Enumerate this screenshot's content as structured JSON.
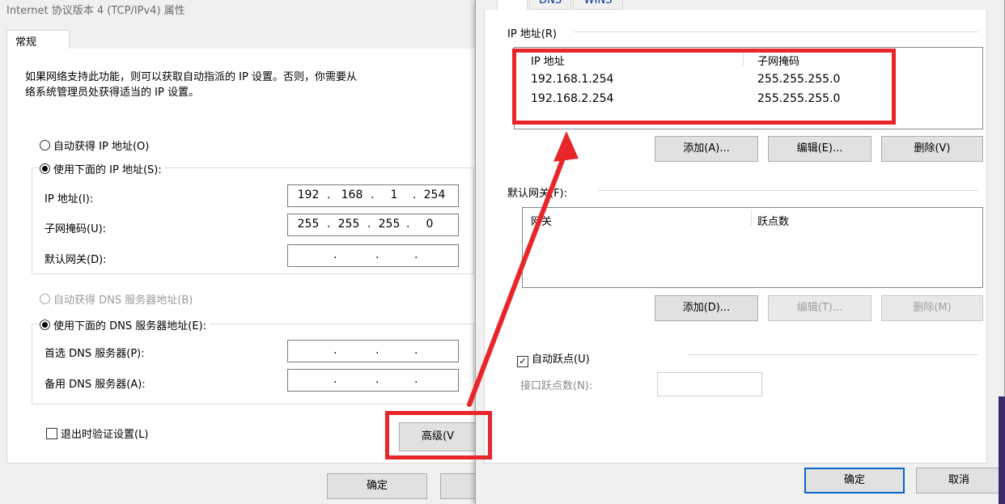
{
  "left_dialog": {
    "title": "Internet 协议版本 4 (TCP/IPv4) 属性",
    "tab_general": "常规",
    "description_line1": "如果网络支持此功能，则可以获取自动指派的 IP 设置。否则，你需要从",
    "description_line2": "络系统管理员处获得适当的 IP 设置。",
    "auto_ip_label": "自动获得 IP 地址(O)",
    "manual_ip_label": "使用下面的 IP 地址(S):",
    "ip_label": "IP 地址(I):",
    "ip_octets": [
      "192",
      "168",
      "1",
      "254"
    ],
    "mask_label": "子网掩码(U):",
    "mask_octets": [
      "255",
      "255",
      "255",
      "0"
    ],
    "gateway_label": "默认网关(D):",
    "auto_dns_label": "自动获得 DNS 服务器地址(B)",
    "manual_dns_label": "使用下面的 DNS 服务器地址(E):",
    "pref_dns_label": "首选 DNS 服务器(P):",
    "alt_dns_label": "备用 DNS 服务器(A):",
    "validate_label": "退出时验证设置(L)",
    "advanced_button": "高级(V",
    "ok_button": "确定"
  },
  "right_dialog": {
    "tab_dns": "DNS",
    "tab_wins": "WINS",
    "ip_group_label": "IP 地址(R)",
    "ip_table": {
      "headers": [
        "IP 地址",
        "子网掩码"
      ],
      "rows": [
        [
          "192.168.1.254",
          "255.255.255.0"
        ],
        [
          "192.168.2.254",
          "255.255.255.0"
        ]
      ]
    },
    "ip_add_button": "添加(A)...",
    "ip_edit_button": "编辑(E)...",
    "ip_delete_button": "删除(V)",
    "gateway_group_label": "默认网关(F):",
    "gateway_table": {
      "headers": [
        "网关",
        "跃点数"
      ]
    },
    "gw_add_button": "添加(D)...",
    "gw_edit_button": "编辑(T)...",
    "gw_delete_button": "删除(M)",
    "auto_metric_label": "自动跃点(U)",
    "interface_metric_label": "接口跃点数(N):",
    "ok_button": "确定",
    "cancel_button": "取消"
  },
  "colors": {
    "highlight": "#e8262a",
    "primary_border": "#0a64c8"
  }
}
